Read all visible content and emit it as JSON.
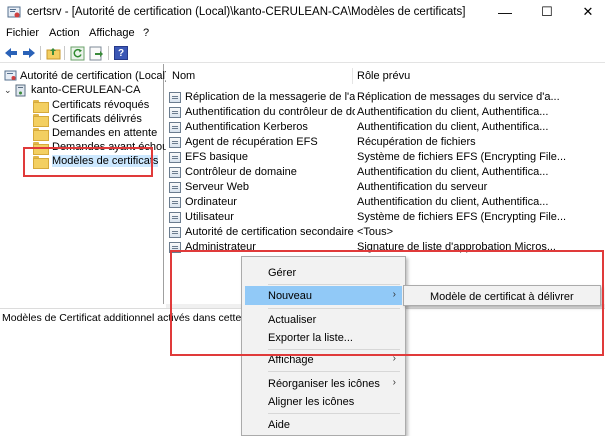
{
  "window": {
    "title": "certsrv - [Autorité de certification (Local)\\kanto-CERULEAN-CA\\Modèles de certificats]",
    "minimize": "—",
    "maximize": "☐",
    "close": "✕"
  },
  "menubar": [
    "Fichier",
    "Action",
    "Affichage",
    "?"
  ],
  "toolbar": {
    "buttons": [
      "back-icon",
      "forward-icon",
      "up-folder-icon",
      "refresh-icon",
      "export-icon",
      "help-icon"
    ],
    "help_label": "?"
  },
  "tree": {
    "root": "Autorité de certification (Local)",
    "ca": "kanto-CERULEAN-CA",
    "items": [
      "Certificats révoqués",
      "Certificats délivrés",
      "Demandes en attente",
      "Demandes ayant échoué",
      "Modèles de certificats"
    ],
    "selected": "Modèles de certificats"
  },
  "list": {
    "columns": [
      "Nom",
      "Rôle prévu"
    ],
    "rows": [
      {
        "name": "Réplication de la messagerie de l'ann...",
        "role": "Réplication de messages du service d'a..."
      },
      {
        "name": "Authentification du contrôleur de do...",
        "role": "Authentification du client, Authentifica..."
      },
      {
        "name": "Authentification Kerberos",
        "role": "Authentification du client, Authentifica..."
      },
      {
        "name": "Agent de récupération EFS",
        "role": "Récupération de fichiers"
      },
      {
        "name": "EFS basique",
        "role": "Système de fichiers EFS (Encrypting File..."
      },
      {
        "name": "Contrôleur de domaine",
        "role": "Authentification du client, Authentifica..."
      },
      {
        "name": "Serveur Web",
        "role": "Authentification du serveur"
      },
      {
        "name": "Ordinateur",
        "role": "Authentification du client, Authentifica..."
      },
      {
        "name": "Utilisateur",
        "role": "Système de fichiers EFS (Encrypting File..."
      },
      {
        "name": "Autorité de certification secondaire",
        "role": "<Tous>"
      },
      {
        "name": "Administrateur",
        "role": "Signature de liste d'approbation Micros..."
      }
    ]
  },
  "status": "Modèles de Certificat additionnel activés dans cette autorité",
  "context_menu": {
    "items": [
      {
        "label": "Gérer",
        "submenu": false
      },
      {
        "label": "Nouveau",
        "submenu": true,
        "highlighted": true
      },
      {
        "label": "Actualiser",
        "submenu": false
      },
      {
        "label": "Exporter la liste...",
        "submenu": false
      },
      {
        "label": "Affichage",
        "submenu": true
      },
      {
        "label": "Réorganiser les icônes",
        "submenu": true
      },
      {
        "label": "Aligner les icônes",
        "submenu": false
      },
      {
        "label": "Aide",
        "submenu": false
      }
    ],
    "arrow": "›"
  },
  "submenu": {
    "item": "Modèle de certificat à délivrer"
  },
  "annotation_color": "#e03a3a"
}
